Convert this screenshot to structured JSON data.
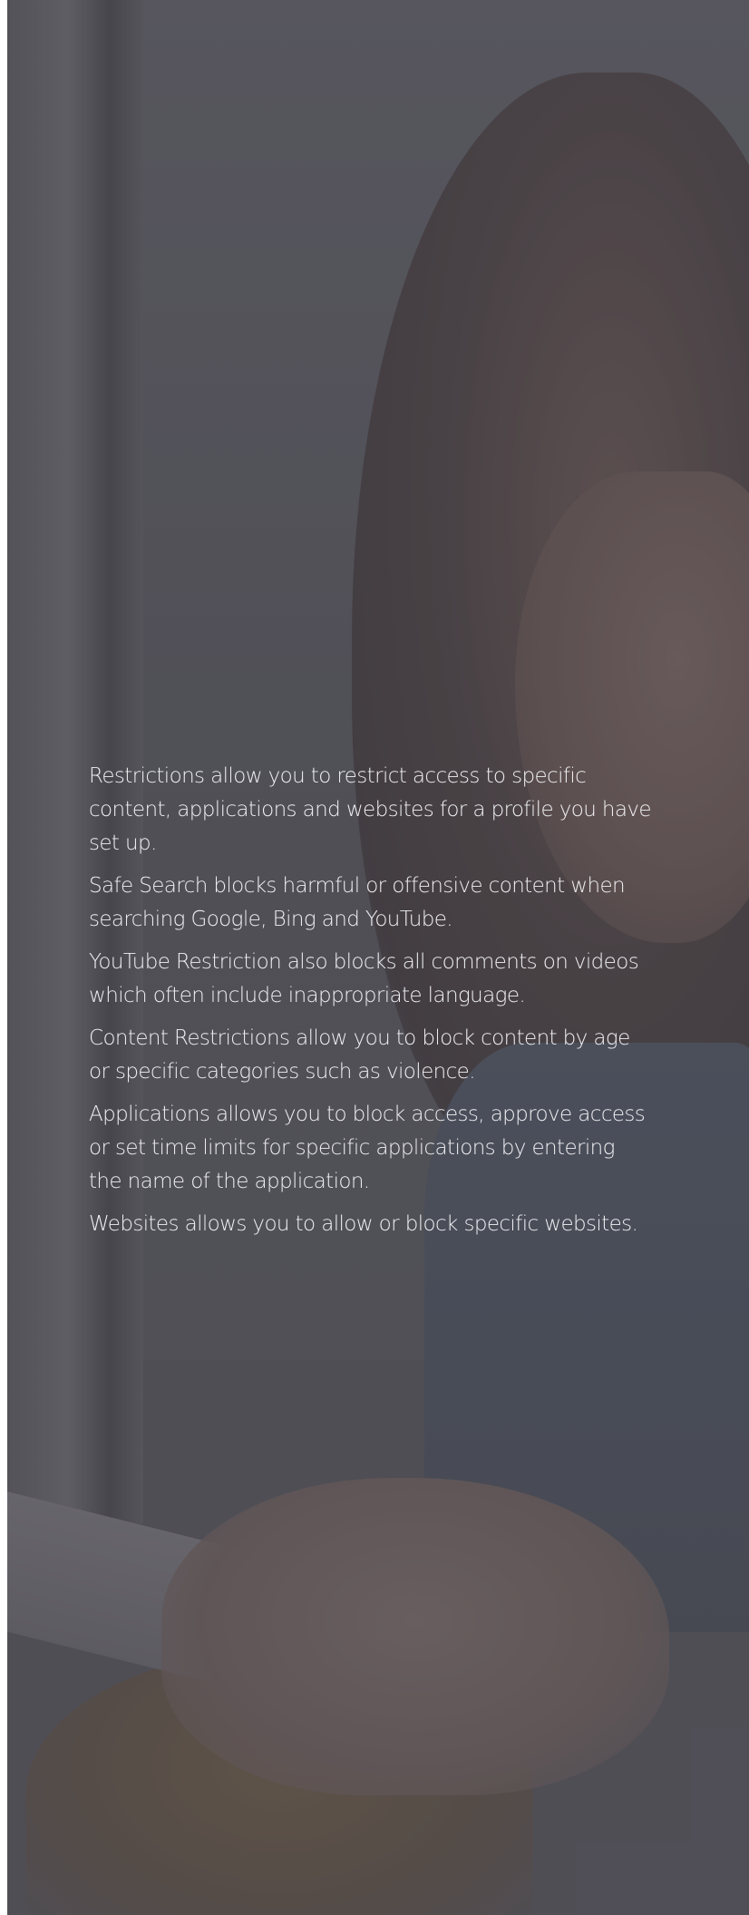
{
  "hero": {
    "paragraphs": [
      "Restrictions allow you to restrict access to specific content, applications and websites for a profile you have set up.",
      "Safe Search blocks harmful or offensive content when searching Google, Bing and YouTube.",
      "YouTube Restriction also blocks all comments on videos which often include inappropriate language.",
      "Content Restrictions allow you to block content by age or specific categories such as violence.",
      "Applications allows you to block access, approve access or set time limits for specific applications by entering the name of the application.",
      "Websites allows you to allow or block specific websites."
    ]
  },
  "colors": {
    "text": "#efeff2",
    "overlay": "#46464e"
  }
}
